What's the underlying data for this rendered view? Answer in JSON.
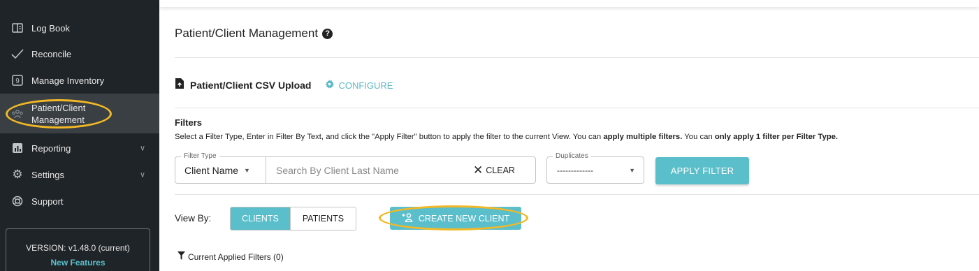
{
  "sidebar": {
    "items": [
      {
        "label": "Log Book",
        "icon": "book-icon"
      },
      {
        "label": "Reconcile",
        "icon": "check-icon"
      },
      {
        "label": "Manage Inventory",
        "icon": "inventory-icon"
      },
      {
        "label": "Patient/Client Management",
        "icon": "people-icon",
        "active": true
      },
      {
        "label": "Reporting",
        "icon": "chart-icon",
        "expandable": true
      },
      {
        "label": "Settings",
        "icon": "gear-icon",
        "expandable": true
      },
      {
        "label": "Support",
        "icon": "lifebuoy-icon"
      }
    ],
    "version": "VERSION: v1.48.0 (current)",
    "new_features": "New Features"
  },
  "main": {
    "title": "Patient/Client Management",
    "upload_label": "Patient/Client CSV Upload",
    "configure_label": "CONFIGURE",
    "filters": {
      "title": "Filters",
      "desc_part1": "Select a Filter Type, Enter in Filter By Text, and click the \"Apply Filter\" button to apply the filter to the current View. You can ",
      "desc_bold1": "apply multiple filters.",
      "desc_part2": " You can ",
      "desc_bold2": "only apply 1 filter per Filter Type.",
      "filter_type_legend": "Filter Type",
      "filter_type_value": "Client Name",
      "search_placeholder": "Search By Client Last Name",
      "clear_label": "CLEAR",
      "duplicates_legend": "Duplicates",
      "duplicates_value": "-------------",
      "apply_label": "APPLY FILTER"
    },
    "view_by": {
      "label": "View By:",
      "options": [
        "CLIENTS",
        "PATIENTS"
      ],
      "selected": "CLIENTS"
    },
    "create_label": "CREATE NEW CLIENT",
    "applied_filters": "Current Applied Filters (0)"
  },
  "colors": {
    "sidebar_bg": "#1f2428",
    "accent": "#5bbfcb",
    "highlight_ring": "#f2b825"
  }
}
